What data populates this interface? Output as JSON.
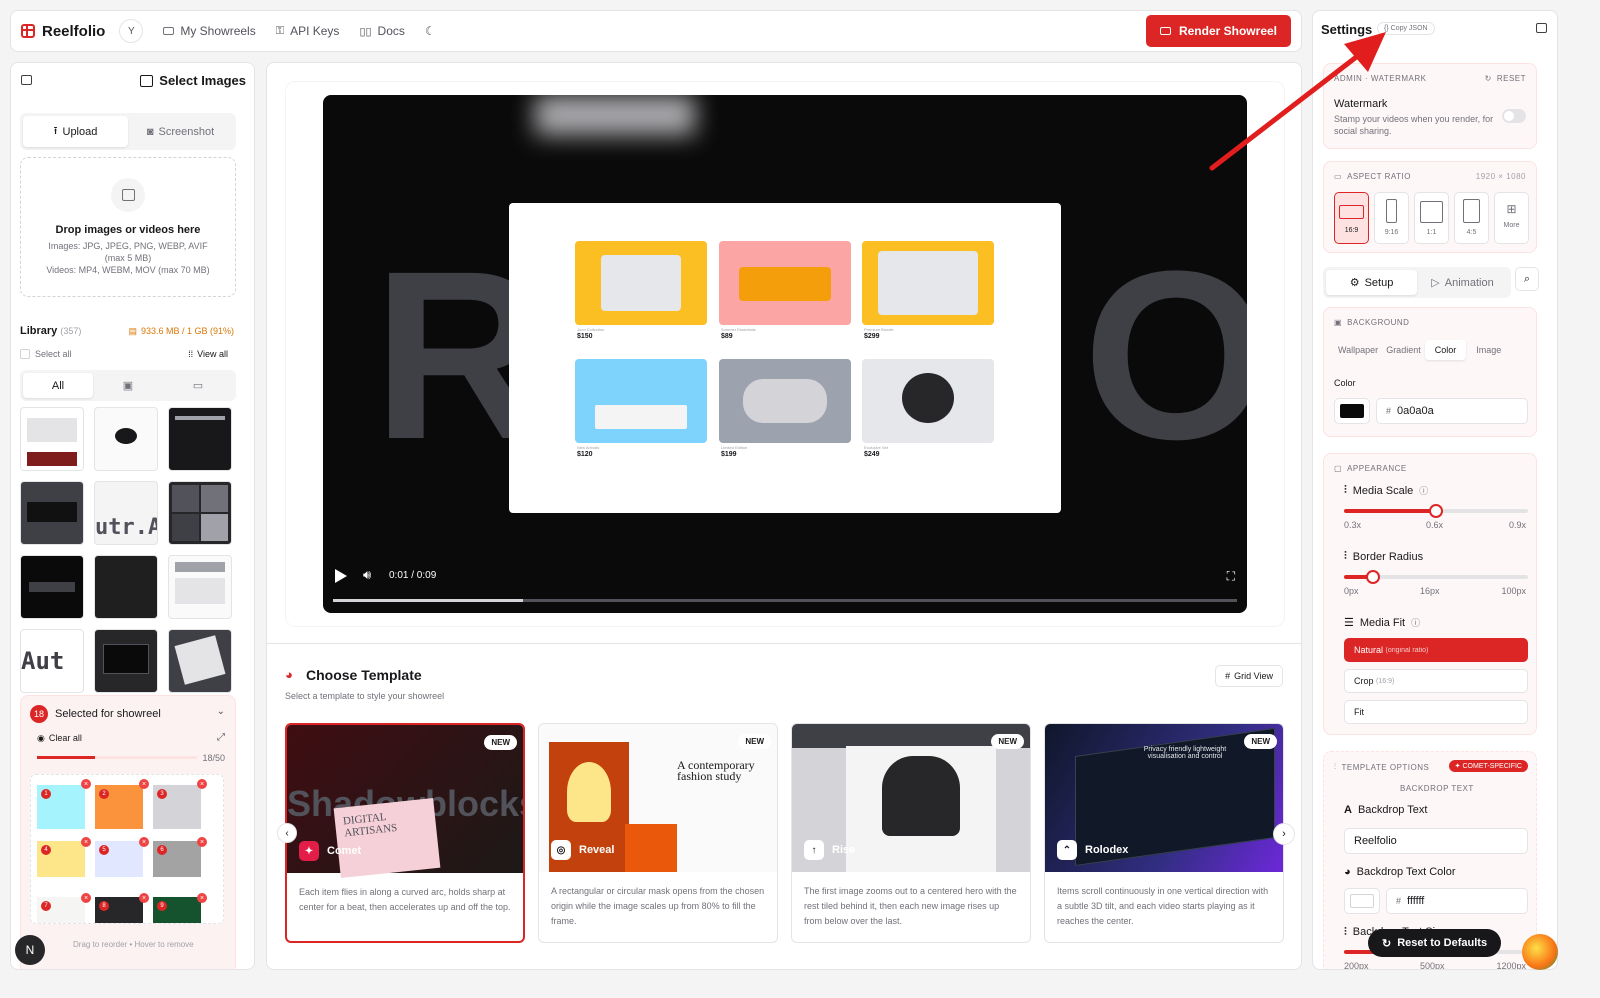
{
  "header": {
    "brand": "Reelfolio",
    "user_initial": "Y",
    "nav": [
      "My Showreels",
      "API Keys",
      "Docs"
    ],
    "render_label": "Render Showreel"
  },
  "left": {
    "title": "Select Images",
    "tabs": [
      "Upload",
      "Screenshot"
    ],
    "drop_title": "Drop images or videos here",
    "drop_img_formats": "Images: JPG, JPEG, PNG, WEBP, AVIF",
    "drop_img_max": "(max 5 MB)",
    "drop_vid_formats": "Videos: MP4, WEBM, MOV (max 70 MB)",
    "library_label": "Library",
    "library_count": "(357)",
    "storage": "933.6 MB / 1 GB (91%)",
    "select_all": "Select all",
    "view_all": "View all",
    "filter_all": "All",
    "thumb_texts": [
      "utr.A",
      "Aut"
    ],
    "selected_count": "18",
    "selected_label": "Selected for showreel",
    "clear_all": "Clear all",
    "progress_text": "18/50",
    "selected_progress": 0.36,
    "drag_hint": "Drag to reorder • Hover to remove",
    "bottom_avatar": "N"
  },
  "preview": {
    "backdrop_letters": [
      "R",
      "O"
    ],
    "products": [
      {
        "price": "$150",
        "name": "Juno Collection"
      },
      {
        "price": "$89",
        "name": "Summer Essentials"
      },
      {
        "price": "$299",
        "name": "Premium Bundle"
      },
      {
        "price": "$120",
        "name": "New Arrivals"
      },
      {
        "price": "$199",
        "name": "Limited Edition"
      },
      {
        "price": "$249",
        "name": "Exclusive Set"
      }
    ],
    "time": "0:01 / 0:09",
    "progress": 0.21
  },
  "templates": {
    "title": "Choose Template",
    "subtitle": "Select a template to style your showreel",
    "grid_view": "Grid View",
    "badge": "NEW",
    "cards": [
      {
        "name": "Comet",
        "desc": "Each item flies in along a curved arc, holds sharp at center for a beat, then accelerates up and off the top.",
        "art_text": "DIGITAL ARTISANS",
        "bg_text": "Shadowblocks"
      },
      {
        "name": "Reveal",
        "desc": "A rectangular or circular mask opens from the chosen origin while the image scales up from 80% to fill the frame.",
        "art_text": "A contemporary fashion study"
      },
      {
        "name": "Rise",
        "desc": "The first image zooms out to a centered hero with the rest tiled behind it, then each new image rises up from below over the last."
      },
      {
        "name": "Rolodex",
        "desc": "Items scroll continuously in one vertical direction with a subtle 3D tilt, and each video starts playing as it reaches the center.",
        "art_text": "Privacy friendly lightweight visualisation and control"
      }
    ]
  },
  "settings": {
    "title": "Settings",
    "copy_json": "Copy JSON",
    "watermark_section": "ADMIN · WATERMARK",
    "reset": "RESET",
    "watermark_title": "Watermark",
    "watermark_desc": "Stamp your videos when you render, for social sharing.",
    "aspect_title": "ASPECT RATIO",
    "aspect_dims": "1920 × 1080",
    "ratios": [
      "16:9",
      "9:16",
      "1:1",
      "4:5",
      "More"
    ],
    "modes": [
      "Setup",
      "Animation"
    ],
    "background_title": "BACKGROUND",
    "bg_tabs": [
      "Wallpaper",
      "Gradient",
      "Color",
      "Image"
    ],
    "color_label": "Color",
    "color_value": "0a0a0a",
    "appearance_title": "APPEARANCE",
    "media_scale": "Media Scale",
    "scale_min": "0.3x",
    "scale_val": "0.6x",
    "scale_max": "0.9x",
    "scale_fraction": 0.5,
    "border_radius": "Border Radius",
    "radius_min": "0px",
    "radius_val": "16px",
    "radius_max": "100px",
    "radius_fraction": 0.16,
    "media_fit": "Media Fit",
    "fit_natural": "Natural",
    "fit_natural_note": "(original ratio)",
    "fit_crop": "Crop",
    "fit_crop_note": "(16:9)",
    "fit_fit": "Fit",
    "template_options": "TEMPLATE OPTIONS",
    "comet_specific": "COMET-SPECIFIC",
    "backdrop_text_section": "BACKDROP TEXT",
    "backdrop_text_label": "Backdrop Text",
    "backdrop_text_value": "Reelfolio",
    "backdrop_color_label": "Backdrop Text Color",
    "backdrop_color_value": "ffffff",
    "backdrop_size_label": "Backdrop Text Size",
    "size_min": "200px",
    "size_val": "500px",
    "size_max": "1200px",
    "reset_defaults": "Reset to Defaults"
  },
  "colors": {
    "accent": "#dc2626",
    "preview_bg": "#0a0a0a",
    "arrow": "#e11d1d"
  }
}
